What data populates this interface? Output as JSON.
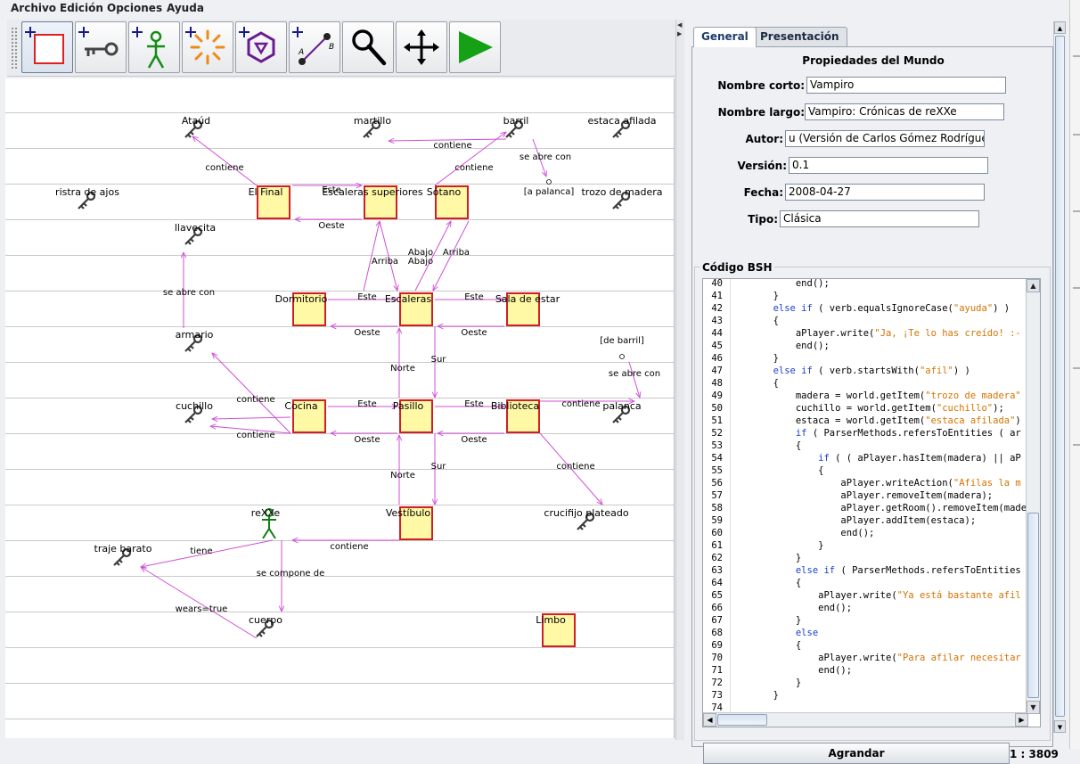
{
  "menu": [
    "Archivo",
    "Edición",
    "Opciones",
    "Ayuda"
  ],
  "toolbar": {
    "tools": [
      {
        "name": "add-room",
        "tooltip": ""
      },
      {
        "name": "add-item",
        "tooltip": ""
      },
      {
        "name": "add-character",
        "tooltip": ""
      },
      {
        "name": "add-spell",
        "tooltip": ""
      },
      {
        "name": "add-ability",
        "tooltip": ""
      },
      {
        "name": "add-link",
        "tooltip": ""
      },
      {
        "name": "select",
        "tooltip": ""
      },
      {
        "name": "move",
        "tooltip": ""
      },
      {
        "name": "run",
        "tooltip": ""
      }
    ]
  },
  "map": {
    "rooms": [
      "El Final",
      "Escaleras superiores",
      "Sótano",
      "Dormitorio",
      "Escaleras",
      "Sala de estar",
      "Cocina",
      "Pasillo",
      "Biblioteca",
      "Vestíbulo",
      "Limbo"
    ],
    "items": [
      "Ataúd",
      "martillo",
      "barril",
      "estaca afilada",
      "ristra de ajos",
      "trozo de madera",
      "llavecita",
      "armario",
      "cuchillo",
      "palanca",
      "crucifijo plateado",
      "traje barato",
      "cuerpo"
    ],
    "characters": [
      "reXXe"
    ],
    "paths": [
      "[a palanca]",
      "[de barril]"
    ],
    "edge_labels": {
      "contiene": "contiene",
      "este": "Este",
      "oeste": "Oeste",
      "norte": "Norte",
      "sur": "Sur",
      "arriba": "Arriba",
      "abajo": "Abajo",
      "se_abre_con": "se abre con",
      "tiene": "tiene",
      "se_compone_de": "se compone de",
      "wears": "wears=true"
    }
  },
  "panel": {
    "tabs": [
      "General",
      "Presentación"
    ],
    "title": "Propiedades del Mundo",
    "fields": {
      "short_name": {
        "label": "Nombre corto:",
        "value": "Vampiro"
      },
      "long_name": {
        "label": "Nombre largo:",
        "value": "Vampiro: Crónicas de reXXe"
      },
      "author": {
        "label": "Autor:",
        "value": "u (Versión de Carlos Gómez Rodríguez)"
      },
      "version": {
        "label": "Versión:",
        "value": "0.1"
      },
      "date": {
        "label": "Fecha:",
        "value": "2008-04-27"
      },
      "type": {
        "label": "Tipo:",
        "value": "Clásica"
      }
    },
    "code_title": "Código BSH",
    "code": [
      {
        "n": "40",
        "t": "            end();"
      },
      {
        "n": "41",
        "t": "        }"
      },
      {
        "n": "42",
        "t": "        else if ( verb.equalsIgnoreCase(\"ayuda\") )"
      },
      {
        "n": "43",
        "t": "        {"
      },
      {
        "n": "44",
        "t": "            aPlayer.write(\"Ja, ¡Te lo has creído! :-"
      },
      {
        "n": "45",
        "t": "            end();"
      },
      {
        "n": "46",
        "t": "        }"
      },
      {
        "n": "47",
        "t": "        else if ( verb.startsWith(\"afil\") )"
      },
      {
        "n": "48",
        "t": "        {"
      },
      {
        "n": "49",
        "t": "            madera = world.getItem(\"trozo de madera\""
      },
      {
        "n": "50",
        "t": "            cuchillo = world.getItem(\"cuchillo\");"
      },
      {
        "n": "51",
        "t": "            estaca = world.getItem(\"estaca afilada\")"
      },
      {
        "n": "52",
        "t": "            if ( ParserMethods.refersToEntities ( ar"
      },
      {
        "n": "53",
        "t": "            {"
      },
      {
        "n": "54",
        "t": "                if ( ( aPlayer.hasItem(madera) || aP"
      },
      {
        "n": "55",
        "t": "                {"
      },
      {
        "n": "56",
        "t": "                    aPlayer.writeAction(\"Afilas la m"
      },
      {
        "n": "57",
        "t": "                    aPlayer.removeItem(madera);"
      },
      {
        "n": "58",
        "t": "                    aPlayer.getRoom().removeItem(made"
      },
      {
        "n": "59",
        "t": "                    aPlayer.addItem(estaca);"
      },
      {
        "n": "60",
        "t": "                    end();"
      },
      {
        "n": "61",
        "t": "                }"
      },
      {
        "n": "62",
        "t": "            }"
      },
      {
        "n": "63",
        "t": "            else if ( ParserMethods.refersToEntities"
      },
      {
        "n": "64",
        "t": "            {"
      },
      {
        "n": "65",
        "t": "                aPlayer.write(\"Ya está bastante afil"
      },
      {
        "n": "66",
        "t": "                end();"
      },
      {
        "n": "67",
        "t": "            }"
      },
      {
        "n": "68",
        "t": "            else"
      },
      {
        "n": "69",
        "t": "            {"
      },
      {
        "n": "70",
        "t": "                aPlayer.write(\"Para afilar necesitar"
      },
      {
        "n": "71",
        "t": "                end();"
      },
      {
        "n": "72",
        "t": "            }"
      },
      {
        "n": "73",
        "t": "        }"
      },
      {
        "n": "74",
        "t": ""
      },
      {
        "n": "75",
        "t": "}"
      }
    ],
    "grow_button": "Agrandar",
    "zoom": "1 : 3809"
  },
  "colors": {
    "room_fill": "#fff9a6",
    "room_border": "#d11f26",
    "edge": "#d04fd6",
    "code_keyword": "#1d3fd0",
    "code_string": "#d47300"
  }
}
